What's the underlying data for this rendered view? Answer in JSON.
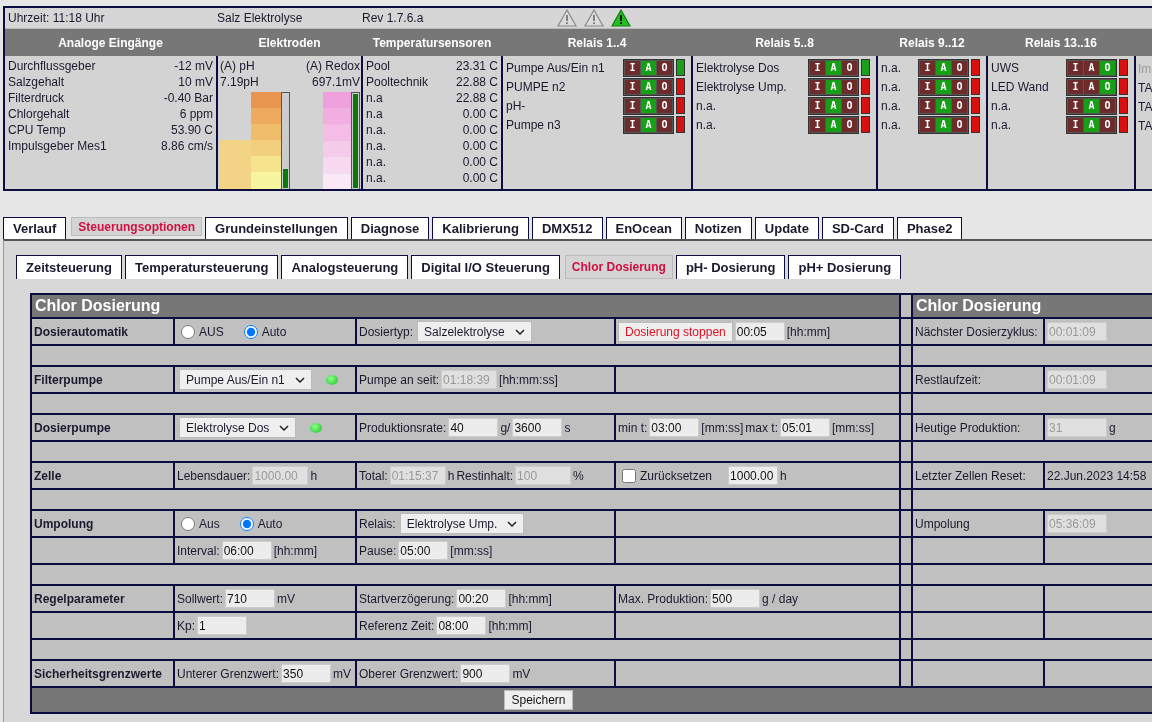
{
  "status": {
    "clock": "Uhrzeit: 11:18 Uhr",
    "title": "Salz Elektrolyse",
    "version": "Rev 1.7.6.a",
    "warnings": [
      {
        "active": false
      },
      {
        "active": false
      },
      {
        "active": true
      }
    ]
  },
  "analog": {
    "title": "Analoge Eingänge",
    "rows": [
      {
        "name": "Durchflussgeber",
        "value": "-12 mV"
      },
      {
        "name": "Salzgehalt",
        "value": "10 mV"
      },
      {
        "name": "Filterdruck",
        "value": "-0.40 Bar"
      },
      {
        "name": "Chlorgehalt",
        "value": "6 ppm"
      },
      {
        "name": "CPU Temp",
        "value": "53.90 C"
      },
      {
        "name": "Impulsgeber Mes1",
        "value": "8.86 cm/s"
      }
    ]
  },
  "electrodes": {
    "title": "Elektroden",
    "items": [
      {
        "label": "(A) pH",
        "value": "7.19pH",
        "level": 0.2
      },
      {
        "label": "(A) Redox",
        "value": "697.1mV",
        "level": 1
      }
    ]
  },
  "temperatures": {
    "title": "Temperatursensoren",
    "rows": [
      {
        "name": "Pool",
        "value": "23.31 C"
      },
      {
        "name": "Pooltechnik",
        "value": "22.88 C"
      },
      {
        "name": "n.a",
        "value": "22.88 C"
      },
      {
        "name": "n.a",
        "value": "0.00 C"
      },
      {
        "name": "n.a.",
        "value": "0.00 C"
      },
      {
        "name": "n.a.",
        "value": "0.00 C"
      },
      {
        "name": "n.a.",
        "value": "0.00 C"
      },
      {
        "name": "n.a.",
        "value": "0.00 C"
      }
    ]
  },
  "relay_groups": [
    {
      "title": "Relais 1..4",
      "relays": [
        {
          "name": "Pumpe Aus/Ein n1",
          "switch": [
            {
              "label": "I",
              "selected": false
            },
            {
              "label": "A",
              "selected": true
            },
            {
              "label": "O",
              "selected": false
            }
          ],
          "on": true
        },
        {
          "name": "PUMPE n2",
          "switch": [
            {
              "label": "I",
              "selected": false
            },
            {
              "label": "A",
              "selected": true
            },
            {
              "label": "O",
              "selected": false
            }
          ],
          "on": false
        },
        {
          "name": "pH-",
          "switch": [
            {
              "label": "I",
              "selected": false
            },
            {
              "label": "A",
              "selected": true
            },
            {
              "label": "O",
              "selected": false
            }
          ],
          "on": false
        },
        {
          "name": "Pumpe n3",
          "switch": [
            {
              "label": "I",
              "selected": false
            },
            {
              "label": "A",
              "selected": true
            },
            {
              "label": "O",
              "selected": false
            }
          ],
          "on": false
        }
      ]
    },
    {
      "title": "Relais 5..8",
      "relays": [
        {
          "name": "Elektrolyse Dos",
          "switch": [
            {
              "label": "I",
              "selected": false
            },
            {
              "label": "A",
              "selected": true
            },
            {
              "label": "O",
              "selected": false
            }
          ],
          "on": true
        },
        {
          "name": "Elektrolyse Ump.",
          "switch": [
            {
              "label": "I",
              "selected": false
            },
            {
              "label": "A",
              "selected": true
            },
            {
              "label": "O",
              "selected": false
            }
          ],
          "on": false
        },
        {
          "name": "n.a.",
          "switch": [
            {
              "label": "I",
              "selected": false
            },
            {
              "label": "A",
              "selected": true
            },
            {
              "label": "O",
              "selected": false
            }
          ],
          "on": false
        },
        {
          "name": "n.a.",
          "switch": [
            {
              "label": "I",
              "selected": false
            },
            {
              "label": "A",
              "selected": true
            },
            {
              "label": "O",
              "selected": false
            }
          ],
          "on": false
        }
      ]
    },
    {
      "title": "Relais 9..12",
      "relays": [
        {
          "name": "n.a.",
          "switch": [
            {
              "label": "I",
              "selected": false
            },
            {
              "label": "A",
              "selected": true
            },
            {
              "label": "O",
              "selected": false
            }
          ],
          "on": false
        },
        {
          "name": "n.a.",
          "switch": [
            {
              "label": "I",
              "selected": false
            },
            {
              "label": "A",
              "selected": true
            },
            {
              "label": "O",
              "selected": false
            }
          ],
          "on": false
        },
        {
          "name": "n.a.",
          "switch": [
            {
              "label": "I",
              "selected": false
            },
            {
              "label": "A",
              "selected": true
            },
            {
              "label": "O",
              "selected": false
            }
          ],
          "on": false
        },
        {
          "name": "n.a.",
          "switch": [
            {
              "label": "I",
              "selected": false
            },
            {
              "label": "A",
              "selected": true
            },
            {
              "label": "O",
              "selected": false
            }
          ],
          "on": false
        }
      ]
    },
    {
      "title": "Relais 13..16",
      "relays": [
        {
          "name": "UWS",
          "switch": [
            {
              "label": "I",
              "selected": false
            },
            {
              "label": "A",
              "selected": false
            },
            {
              "label": "O",
              "selected": true
            }
          ],
          "on": false
        },
        {
          "name": "LED Wand",
          "switch": [
            {
              "label": "I",
              "selected": false
            },
            {
              "label": "A",
              "selected": false
            },
            {
              "label": "O",
              "selected": true
            }
          ],
          "on": false
        },
        {
          "name": "n.a.",
          "switch": [
            {
              "label": "I",
              "selected": false
            },
            {
              "label": "A",
              "selected": true
            },
            {
              "label": "O",
              "selected": false
            }
          ],
          "on": false
        },
        {
          "name": "n.a.",
          "switch": [
            {
              "label": "I",
              "selected": false
            },
            {
              "label": "A",
              "selected": true
            },
            {
              "label": "O",
              "selected": false
            }
          ],
          "on": false
        }
      ]
    }
  ],
  "cut_column": {
    "items": [
      {
        "text": "Im",
        "disabled": true
      },
      {
        "text": "TA",
        "disabled": false
      },
      {
        "text": "TA",
        "disabled": false
      },
      {
        "text": "TA",
        "disabled": false
      }
    ]
  },
  "tabs": [
    {
      "label": "Verlauf",
      "selected": false
    },
    {
      "label": "Steuerungsoptionen",
      "selected": true
    },
    {
      "label": "Grundeinstellungen",
      "selected": false
    },
    {
      "label": "Diagnose",
      "selected": false
    },
    {
      "label": "Kalibrierung",
      "selected": false
    },
    {
      "label": "DMX512",
      "selected": false
    },
    {
      "label": "EnOcean",
      "selected": false
    },
    {
      "label": "Notizen",
      "selected": false
    },
    {
      "label": "Update",
      "selected": false
    },
    {
      "label": "SD-Card",
      "selected": false
    },
    {
      "label": "Phase2",
      "selected": false
    }
  ],
  "subtabs": [
    {
      "label": "Zeitsteuerung",
      "selected": false
    },
    {
      "label": "Temperatursteuerung",
      "selected": false
    },
    {
      "label": "Analogsteuerung",
      "selected": false
    },
    {
      "label": "Digital I/O Steuerung",
      "selected": false
    },
    {
      "label": "Chlor Dosierung",
      "selected": true
    },
    {
      "label": "pH- Dosierung",
      "selected": false
    },
    {
      "label": "pH+ Dosierung",
      "selected": false
    }
  ],
  "dosing": {
    "title": "Chlor Dosierung",
    "side_title": "Chlor Dosierung",
    "save_button": "Speichern",
    "groups": [
      {
        "lines": [
          {
            "label": "Dosierautomatik",
            "cells": [
              [
                {
                  "kind": "radio",
                  "label": "AUS",
                  "selected": false
                },
                {
                  "kind": "radio",
                  "label": "Auto",
                  "selected": true
                }
              ],
              [
                {
                  "kind": "text",
                  "text": "Dosiertyp:"
                },
                {
                  "kind": "select",
                  "value": "Salzelektrolyse"
                }
              ],
              [
                {
                  "kind": "button",
                  "label": "Dosierung stoppen"
                },
                {
                  "kind": "input",
                  "value": "00:05",
                  "disabled": false
                },
                {
                  "kind": "text",
                  "text": "[hh:mm]"
                }
              ]
            ],
            "side_label": "Nächster Dosierzyklus:",
            "side": [
              {
                "kind": "input",
                "value": "00:01:09",
                "disabled": true
              }
            ]
          }
        ]
      },
      {
        "lines": [
          {
            "label": "Filterpumpe",
            "cells": [
              [
                {
                  "kind": "select",
                  "value": "Pumpe Aus/Ein n1"
                },
                {
                  "kind": "led",
                  "on": true
                }
              ],
              [
                {
                  "kind": "text",
                  "text": "Pumpe an seit:"
                },
                {
                  "kind": "input",
                  "value": "01:18:39",
                  "disabled": true
                },
                {
                  "kind": "text",
                  "text": "[hh:mm:ss]"
                }
              ],
              []
            ],
            "side_label": "Restlaufzeit:",
            "side": [
              {
                "kind": "input",
                "value": "00:01:09",
                "disabled": true
              }
            ]
          }
        ]
      },
      {
        "lines": [
          {
            "label": "Dosierpumpe",
            "cells": [
              [
                {
                  "kind": "select",
                  "value": "Elektrolyse Dos"
                },
                {
                  "kind": "led",
                  "on": true
                }
              ],
              [
                {
                  "kind": "text",
                  "text": "Produktionsrate:"
                },
                {
                  "kind": "input",
                  "value": "40",
                  "disabled": false
                },
                {
                  "kind": "text",
                  "text": "g/"
                },
                {
                  "kind": "input",
                  "value": "3600",
                  "disabled": false
                },
                {
                  "kind": "text",
                  "text": "s"
                }
              ],
              [
                {
                  "kind": "text",
                  "text": "min t:"
                },
                {
                  "kind": "input",
                  "value": "03:00",
                  "disabled": false
                },
                {
                  "kind": "text",
                  "text": "[mm:ss]"
                },
                {
                  "kind": "text",
                  "text": "max t:"
                },
                {
                  "kind": "input",
                  "value": "05:01",
                  "disabled": false
                },
                {
                  "kind": "text",
                  "text": "[mm:ss]"
                }
              ]
            ],
            "side_label": "Heutige Produktion:",
            "side": [
              {
                "kind": "input",
                "value": "31",
                "disabled": true
              },
              {
                "kind": "text",
                "text": "g"
              }
            ]
          }
        ]
      },
      {
        "lines": [
          {
            "label": "Zelle",
            "cells": [
              [
                {
                  "kind": "text",
                  "text": "Lebensdauer:"
                },
                {
                  "kind": "input",
                  "value": "1000.00",
                  "disabled": true
                },
                {
                  "kind": "text",
                  "text": "h"
                }
              ],
              [
                {
                  "kind": "text",
                  "text": "Total:"
                },
                {
                  "kind": "input",
                  "value": "01:15:37",
                  "disabled": true
                },
                {
                  "kind": "text",
                  "text": "h"
                },
                {
                  "kind": "text",
                  "text": "Restinhalt:"
                },
                {
                  "kind": "input",
                  "value": "100",
                  "disabled": true
                },
                {
                  "kind": "text",
                  "text": "%"
                }
              ],
              [
                {
                  "kind": "checkbox",
                  "label": "Zurücksetzen",
                  "checked": false
                },
                {
                  "kind": "input",
                  "value": "1000.00",
                  "disabled": false
                },
                {
                  "kind": "text",
                  "text": "h"
                }
              ]
            ],
            "side_label": "Letzter Zellen Reset:",
            "side": [
              {
                "kind": "text",
                "text": "22.Jun.2023 14:58"
              }
            ]
          }
        ]
      },
      {
        "lines": [
          {
            "label": "Umpolung",
            "cells": [
              [
                {
                  "kind": "radio",
                  "label": "Aus",
                  "selected": false
                },
                {
                  "kind": "radio",
                  "label": "Auto",
                  "selected": true
                }
              ],
              [
                {
                  "kind": "text",
                  "text": "Relais:"
                },
                {
                  "kind": "select",
                  "value": "Elektrolyse Ump."
                }
              ],
              []
            ],
            "side_label": "Umpolung",
            "side": [
              {
                "kind": "input",
                "value": "05:36:09",
                "disabled": true
              }
            ]
          },
          {
            "cells": [
              [
                {
                  "kind": "text",
                  "text": "Interval:"
                },
                {
                  "kind": "input",
                  "value": "06:00",
                  "disabled": false
                },
                {
                  "kind": "text",
                  "text": "[hh:mm]"
                }
              ],
              [
                {
                  "kind": "text",
                  "text": "Pause:"
                },
                {
                  "kind": "input",
                  "value": "05:00",
                  "disabled": false
                },
                {
                  "kind": "text",
                  "text": "[mm:ss]"
                }
              ],
              []
            ]
          }
        ]
      },
      {
        "lines": [
          {
            "label": "Regelparameter",
            "cells": [
              [
                {
                  "kind": "text",
                  "text": "Sollwert:"
                },
                {
                  "kind": "input",
                  "value": "710",
                  "disabled": false
                },
                {
                  "kind": "text",
                  "text": "mV"
                }
              ],
              [
                {
                  "kind": "text",
                  "text": "Startverzögerung:"
                },
                {
                  "kind": "input",
                  "value": "00:20",
                  "disabled": false
                },
                {
                  "kind": "text",
                  "text": "[hh:mm]"
                }
              ],
              [
                {
                  "kind": "text",
                  "text": "Max. Produktion:"
                },
                {
                  "kind": "input",
                  "value": "500",
                  "disabled": false
                },
                {
                  "kind": "text",
                  "text": "g / day"
                }
              ]
            ]
          },
          {
            "cells": [
              [
                {
                  "kind": "text",
                  "text": "Kp:"
                },
                {
                  "kind": "input",
                  "value": "1",
                  "disabled": false
                }
              ],
              [
                {
                  "kind": "text",
                  "text": "Referenz Zeit:"
                },
                {
                  "kind": "input",
                  "value": "08:00",
                  "disabled": false
                },
                {
                  "kind": "text",
                  "text": "[hh:mm]"
                }
              ],
              []
            ]
          }
        ]
      },
      {
        "lines": [
          {
            "label": "Sicherheitsgrenzwerte",
            "cells": [
              [
                {
                  "kind": "text",
                  "text": "Unterer Grenzwert:"
                },
                {
                  "kind": "input",
                  "value": "350",
                  "disabled": false
                },
                {
                  "kind": "text",
                  "text": "mV"
                }
              ],
              [
                {
                  "kind": "text",
                  "text": "Oberer Grenzwert:"
                },
                {
                  "kind": "input",
                  "value": "900",
                  "disabled": false
                },
                {
                  "kind": "text",
                  "text": "mV"
                }
              ],
              []
            ]
          }
        ]
      }
    ]
  }
}
